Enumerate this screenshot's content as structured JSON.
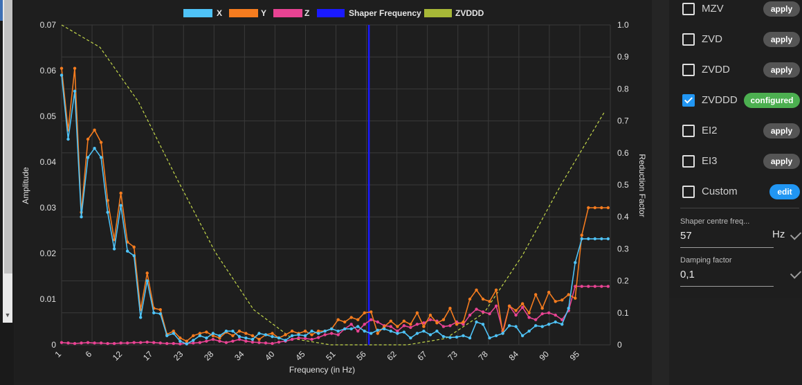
{
  "chart_data": {
    "type": "line",
    "xlabel": "Frequency (in Hz)",
    "ylabel": "Amplitude",
    "y2label": "Reduction Factor",
    "xlim": [
      1,
      101
    ],
    "ylim": [
      0,
      0.07
    ],
    "y2lim": [
      0,
      1.0
    ],
    "x_ticks": [
      "1",
      "6",
      "12",
      "17",
      "23",
      "28",
      "34",
      "40",
      "45",
      "51",
      "56",
      "62",
      "67",
      "73",
      "78",
      "84",
      "90",
      "95"
    ],
    "y_ticks": [
      "0",
      "0.01",
      "0.02",
      "0.03",
      "0.04",
      "0.05",
      "0.06",
      "0.07"
    ],
    "y2_ticks": [
      "0",
      "0.1",
      "0.2",
      "0.3",
      "0.4",
      "0.5",
      "0.6",
      "0.7",
      "0.8",
      "0.9",
      "1.0"
    ],
    "grid": true,
    "legend_position": "top",
    "legend": [
      {
        "name": "X",
        "color": "#4fc3f7"
      },
      {
        "name": "Y",
        "color": "#f57c1f"
      },
      {
        "name": "Z",
        "color": "#e84393"
      },
      {
        "name": "Shaper Frequency",
        "color": "#1a1aff"
      },
      {
        "name": "ZVDDD",
        "color": "#b6c93a"
      }
    ],
    "shaper_frequency": 57,
    "x": [
      1,
      2.2,
      3.4,
      4.6,
      5.8,
      7,
      8.2,
      9.4,
      10.6,
      11.8,
      13,
      14.2,
      15.4,
      16.6,
      17.8,
      19,
      20.2,
      21.4,
      22.6,
      23.8,
      25,
      26.2,
      27.4,
      28.6,
      29.8,
      31,
      32.2,
      33.4,
      34.6,
      35.8,
      37,
      38.2,
      39.4,
      40.6,
      41.8,
      43,
      44.2,
      45.4,
      46.6,
      47.8,
      49,
      50.2,
      51.4,
      52.6,
      53.8,
      55,
      56.2,
      57.4,
      58.6,
      59.8,
      61,
      62.2,
      63.4,
      64.6,
      65.8,
      67,
      68.2,
      69.4,
      70.6,
      71.8,
      73,
      74.2,
      75.4,
      76.6,
      77.8,
      79,
      80.2,
      81.4,
      82.6,
      83.8,
      85,
      86.2,
      87.4,
      88.6,
      89.8,
      91,
      92.2,
      93.4,
      94.6,
      95.8,
      97,
      98.2,
      99.4,
      100.6
    ],
    "series": [
      {
        "name": "X",
        "color": "#4fc3f7",
        "values": [
          0.059,
          0.045,
          0.0555,
          0.028,
          0.041,
          0.043,
          0.041,
          0.029,
          0.021,
          0.0305,
          0.0205,
          0.0195,
          0.006,
          0.014,
          0.007,
          0.0068,
          0.002,
          0.0025,
          0.0008,
          0.0002,
          0.001,
          0.002,
          0.0015,
          0.0025,
          0.002,
          0.003,
          0.003,
          0.0018,
          0.0015,
          0.0012,
          0.0025,
          0.0022,
          0.0018,
          0.0015,
          0.001,
          0.002,
          0.0022,
          0.002,
          0.003,
          0.0025,
          0.003,
          0.0035,
          0.003,
          0.0035,
          0.0035,
          0.004,
          0.003,
          0.0025,
          0.0032,
          0.0035,
          0.003,
          0.0025,
          0.0028,
          0.0015,
          0.0025,
          0.003,
          0.0022,
          0.003,
          0.0018,
          0.0016,
          0.0017,
          0.002,
          0.0015,
          0.005,
          0.0045,
          0.0015,
          0.002,
          0.0025,
          0.0042,
          0.004,
          0.002,
          0.003,
          0.0042,
          0.004,
          0.0045,
          0.005,
          0.0045,
          0.008,
          0.018,
          0.0232,
          0.0232,
          0.0232,
          0.0232,
          0.0232
        ]
      },
      {
        "name": "Y",
        "color": "#f57c1f",
        "values": [
          0.0605,
          0.047,
          0.0605,
          0.029,
          0.045,
          0.047,
          0.0443,
          0.0316,
          0.023,
          0.0332,
          0.0225,
          0.0214,
          0.0077,
          0.0157,
          0.008,
          0.0077,
          0.0023,
          0.003,
          0.0015,
          0.0008,
          0.002,
          0.0025,
          0.0028,
          0.002,
          0.0015,
          0.0028,
          0.002,
          0.003,
          0.0025,
          0.002,
          0.0012,
          0.0022,
          0.0025,
          0.0015,
          0.0022,
          0.003,
          0.0025,
          0.003,
          0.0022,
          0.003,
          0.003,
          0.0035,
          0.0055,
          0.005,
          0.006,
          0.0055,
          0.007,
          0.0072,
          0.0025,
          0.004,
          0.0052,
          0.004,
          0.0052,
          0.0045,
          0.007,
          0.004,
          0.0065,
          0.0048,
          0.0055,
          0.008,
          0.0045,
          0.005,
          0.01,
          0.012,
          0.01,
          0.0095,
          0.012,
          0.0025,
          0.0085,
          0.0075,
          0.009,
          0.007,
          0.011,
          0.008,
          0.0115,
          0.0095,
          0.0098,
          0.011,
          0.0102,
          0.024,
          0.03,
          0.03,
          0.03,
          0.03
        ]
      },
      {
        "name": "Z",
        "color": "#e84393",
        "values": [
          0.0005,
          0.0004,
          0.0003,
          0.0004,
          0.0005,
          0.0004,
          0.0004,
          0.0003,
          0.0003,
          0.0004,
          0.0004,
          0.0005,
          0.0005,
          0.0006,
          0.0005,
          0.0004,
          0.0003,
          0.0003,
          0.0002,
          0.0003,
          0.0004,
          0.0005,
          0.0008,
          0.0012,
          0.0008,
          0.0005,
          0.0008,
          0.0012,
          0.0008,
          0.0006,
          0.0005,
          0.0004,
          0.0003,
          0.0006,
          0.0008,
          0.0012,
          0.0015,
          0.0014,
          0.0012,
          0.0016,
          0.0022,
          0.0025,
          0.0022,
          0.0035,
          0.0045,
          0.003,
          0.0045,
          0.0055,
          0.005,
          0.0042,
          0.004,
          0.003,
          0.0042,
          0.0038,
          0.0045,
          0.0048,
          0.0055,
          0.0052,
          0.004,
          0.0042,
          0.005,
          0.0045,
          0.0065,
          0.0078,
          0.0072,
          0.0068,
          0.0085,
          0.003,
          0.0085,
          0.0065,
          0.0082,
          0.006,
          0.0055,
          0.0068,
          0.007,
          0.0065,
          0.0055,
          0.0075,
          0.0128,
          0.0128,
          0.0128,
          0.0128,
          0.0128,
          0.0128
        ]
      }
    ],
    "reduction_curve": {
      "name": "ZVDDD",
      "x": [
        1,
        8,
        15,
        22,
        29,
        36,
        43,
        50,
        57,
        64,
        71,
        78,
        85,
        92,
        100
      ],
      "values": [
        1.0,
        0.93,
        0.76,
        0.52,
        0.29,
        0.11,
        0.02,
        0.0,
        0.0,
        0.0,
        0.02,
        0.1,
        0.28,
        0.5,
        0.73
      ]
    }
  },
  "shapers": [
    {
      "name": "MZV",
      "checked": false,
      "action": "apply"
    },
    {
      "name": "ZVD",
      "checked": false,
      "action": "apply"
    },
    {
      "name": "ZVDD",
      "checked": false,
      "action": "apply"
    },
    {
      "name": "ZVDDD",
      "checked": true,
      "action": "configured"
    },
    {
      "name": "EI2",
      "checked": false,
      "action": "apply"
    },
    {
      "name": "EI3",
      "checked": false,
      "action": "apply"
    },
    {
      "name": "Custom",
      "checked": false,
      "action": "edit"
    }
  ],
  "shaper_centre_frequency": {
    "label": "Shaper centre freq...",
    "value": "57",
    "suffix": "Hz"
  },
  "damping_factor": {
    "label": "Damping factor",
    "value": "0,1"
  },
  "scroll_down_glyph": "▼"
}
